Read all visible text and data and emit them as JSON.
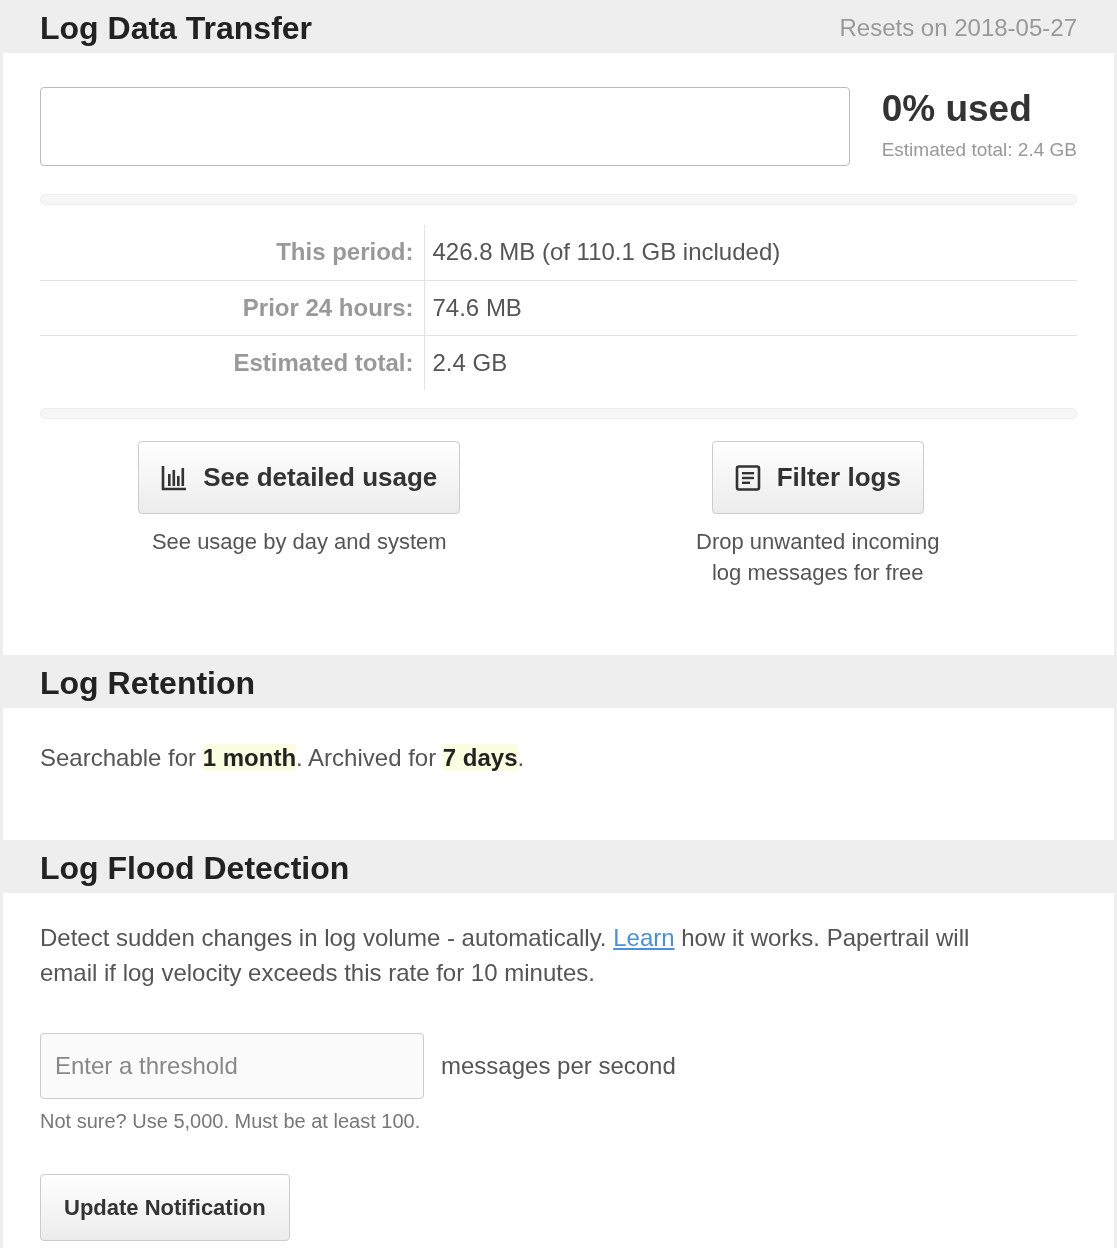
{
  "data_transfer": {
    "title": "Log Data Transfer",
    "reset_note": "Resets on 2018-05-27",
    "usage": {
      "level": 0,
      "label": "0% used",
      "estimate": "Estimated total: 2.4 GB"
    },
    "stats": [
      {
        "label": "This period:",
        "value": "426.8 MB (of 110.1 GB included)"
      },
      {
        "label": "Prior 24 hours:",
        "value": "74.6 MB"
      },
      {
        "label": "Estimated total:",
        "value": "2.4 GB"
      }
    ],
    "actions": [
      {
        "kind": "chart",
        "label": "See detailed usage",
        "caption_lines": [
          "See usage by day and system"
        ]
      },
      {
        "kind": "document",
        "label": "Filter logs",
        "caption_lines": [
          "Drop unwanted incoming",
          "log messages for free"
        ]
      }
    ]
  },
  "retention": {
    "title": "Log Retention",
    "text": "Searchable for **1 month**. Archived for **7 days**."
  },
  "flood_detection": {
    "title": "Log Flood Detection",
    "description": {
      "before": "Detect sudden changes in log volume - automatically.",
      "link": "Learn",
      "after": "how it works. Papertrail will email if log velocity exceeds this rate for 10 minutes."
    },
    "threshold": {
      "placeholder": "Enter a threshold",
      "unit": "messages per second"
    },
    "hint": "Not sure? Use 5,000. Must be at least 100.",
    "button": "Update Notification"
  }
}
